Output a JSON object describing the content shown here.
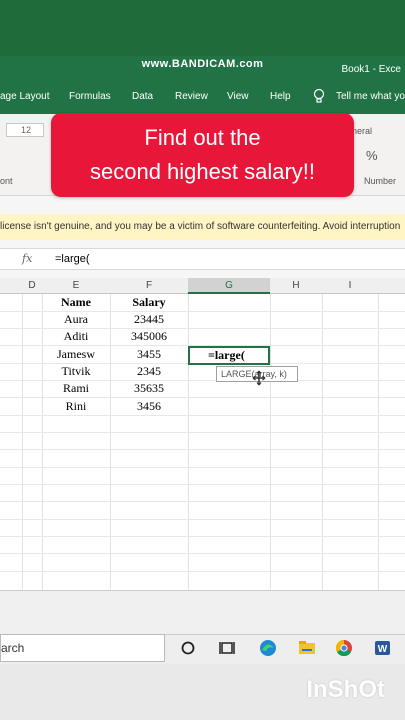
{
  "window": {
    "recorder_watermark": "www.BANDICAM.com",
    "book_title": "Book1 - Exce"
  },
  "ribbon": {
    "tabs": [
      "age Layout",
      "Formulas",
      "Data",
      "Review",
      "View",
      "Help",
      "Tell me what yo"
    ],
    "font_size": "12",
    "group_labels": {
      "font": "ont",
      "number": "Number",
      "style": "neral",
      "percent": "%"
    }
  },
  "banner": {
    "line1": "Find out the",
    "line2": "second highest salary!!"
  },
  "license_bar": {
    "text": "license isn't genuine, and you may be a victim of software counterfeiting. Avoid interruption"
  },
  "formula_bar": {
    "fx_label": "fx",
    "formula": "=large("
  },
  "columns": [
    "D",
    "E",
    "F",
    "G",
    "H",
    "I"
  ],
  "table": {
    "headers": [
      "Name",
      "Salary"
    ],
    "rows": [
      [
        "Aura",
        "23445"
      ],
      [
        "Aditi",
        "345006"
      ],
      [
        "Jamesw",
        "3455"
      ],
      [
        "Titvik",
        "2345"
      ],
      [
        "Rami",
        "35635"
      ],
      [
        "Rini",
        "3456"
      ]
    ]
  },
  "active_cell": {
    "value": "=large(",
    "tooltip": "LARGE(array, k)"
  },
  "taskbar": {
    "search_text": "arch"
  },
  "overlay": {
    "inshot_watermark": "InShOt"
  },
  "colors": {
    "excel_green": "#217346",
    "banner_red": "#e8173a",
    "license_yellow": "#fff4c4"
  }
}
